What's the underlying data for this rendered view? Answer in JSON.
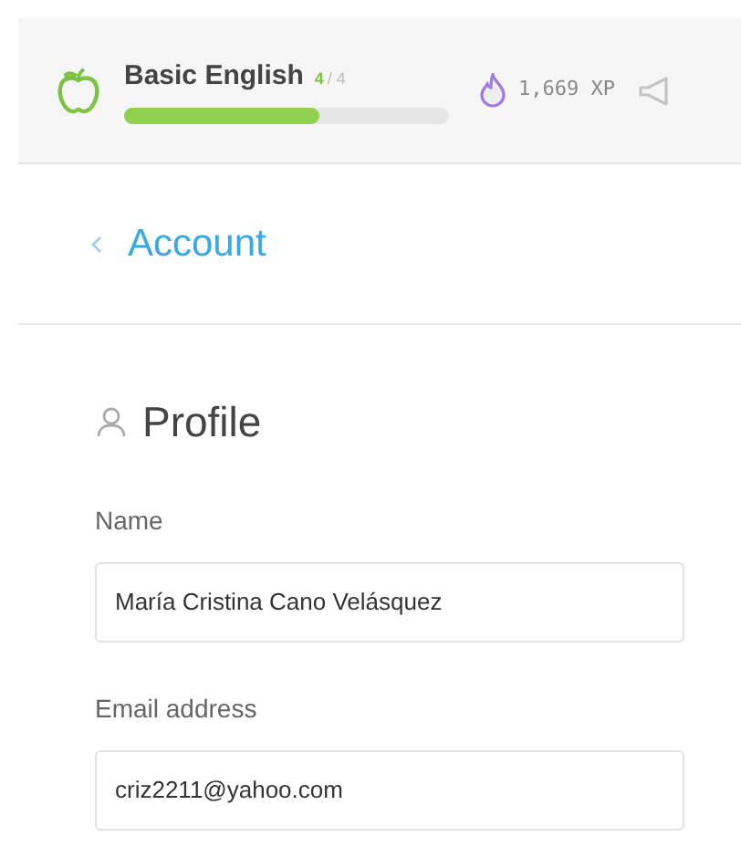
{
  "course": {
    "title": "Basic English",
    "progress_done": "4",
    "progress_total": "/ 4",
    "level": 0.6
  },
  "xp": "1,669 XP",
  "back_link": "Account",
  "section_title": "Profile",
  "fields": [
    {
      "label": "Name",
      "value": "María Cristina Cano Velásquez"
    },
    {
      "label": "Email address",
      "value": "criz2211@yahoo.com"
    }
  ]
}
